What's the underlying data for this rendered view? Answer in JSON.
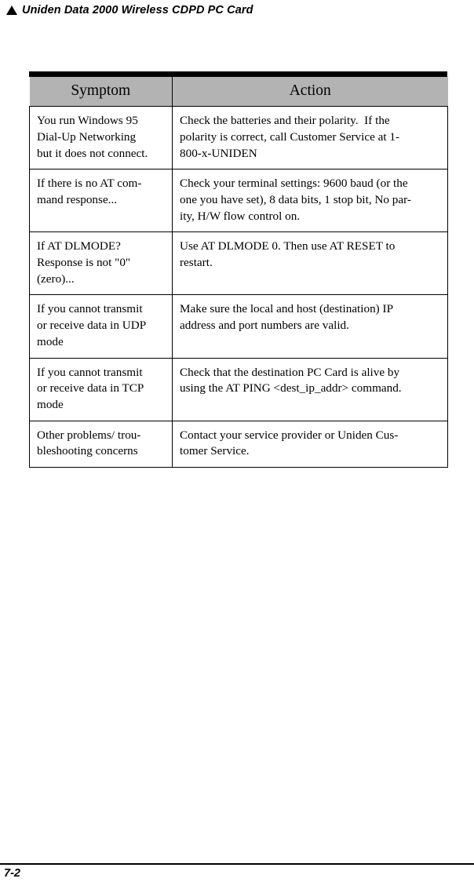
{
  "header": {
    "bullet_icon": "triangle-up-icon",
    "title": "Uniden Data 2000 Wireless CDPD PC Card"
  },
  "table": {
    "columns": [
      {
        "label": "Symptom"
      },
      {
        "label": "Action"
      }
    ],
    "rows": [
      {
        "symptom_lines": [
          "You run Windows 95",
          "Dial-Up Networking",
          "but it does not connect."
        ],
        "action_lines": [
          "Check the batteries and their polarity.  If the",
          "polarity is correct, call Customer Service at 1-",
          "800-x-UNIDEN"
        ]
      },
      {
        "symptom_lines": [
          "If there is no AT com-",
          "mand response..."
        ],
        "action_lines": [
          "Check your terminal settings: 9600 baud (or the",
          "one you have set), 8 data bits, 1 stop bit, No par-",
          "ity, H/W flow control on."
        ]
      },
      {
        "symptom_lines": [
          "If AT DLMODE?",
          "Response is not \"0\"",
          "(zero)..."
        ],
        "action_lines": [
          "Use AT DLMODE 0. Then use AT RESET to",
          "restart."
        ]
      },
      {
        "symptom_lines": [
          "If you cannot transmit",
          "or receive data in UDP",
          "mode"
        ],
        "action_lines": [
          "Make sure the local and host (destination) IP",
          "address and port numbers are valid."
        ]
      },
      {
        "symptom_lines": [
          "If you cannot transmit",
          "or receive data in TCP",
          "mode"
        ],
        "action_lines": [
          "Check that the destination PC Card is alive by",
          "using the AT PING <dest_ip_addr> command."
        ]
      },
      {
        "symptom_lines": [
          "Other problems/ trou-",
          "bleshooting concerns"
        ],
        "action_lines": [
          "Contact your service provider or Uniden Cus-",
          "tomer Service."
        ]
      }
    ]
  },
  "footer": {
    "page_number": "7-2"
  },
  "colors": {
    "header_row_fill": "#b3b3b3",
    "rule": "#000000",
    "page_background": "#ffffff",
    "text": "#000000"
  }
}
